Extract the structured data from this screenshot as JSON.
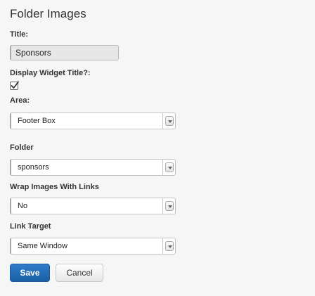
{
  "widget": {
    "heading": "Folder Images"
  },
  "fields": {
    "title": {
      "label": "Title:",
      "value": "Sponsors"
    },
    "display_title": {
      "label": "Display Widget Title?:",
      "checked": true
    },
    "area": {
      "label": "Area:",
      "value": "Footer Box"
    },
    "folder": {
      "label": "Folder",
      "value": "sponsors"
    },
    "wrap_links": {
      "label": "Wrap Images With Links",
      "value": "No"
    },
    "link_target": {
      "label": "Link Target",
      "value": "Same Window"
    }
  },
  "actions": {
    "save_label": "Save",
    "cancel_label": "Cancel"
  },
  "colors": {
    "primary": "#1f6ab4",
    "background": "#f6f6f6"
  },
  "icons": {
    "checkbox": "check-icon",
    "select": "chevron-down-icon"
  }
}
